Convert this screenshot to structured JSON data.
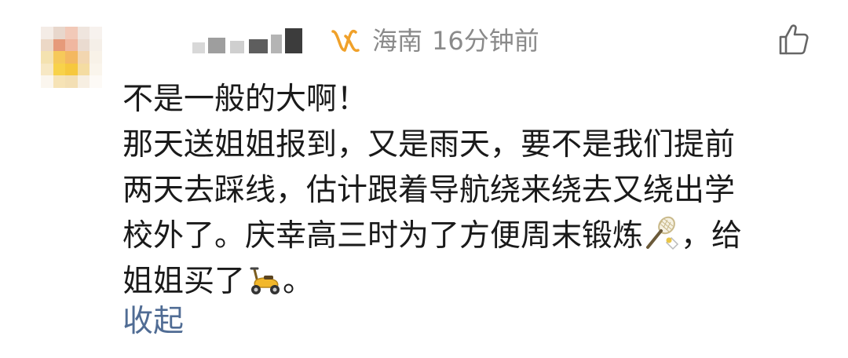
{
  "comment": {
    "location": "海南",
    "time": "16分钟前",
    "text_lines": [
      "不是一般的大啊！",
      "那天送姐姐报到，又是雨天，要不是我们提前",
      "两天去踩线，估计跟着导航绕来绕去又绕出学",
      "校外了。庆幸高三时为了方便周末锻炼",
      "，给",
      "姐姐买了",
      "。"
    ],
    "collapse_label": "收起",
    "icons": {
      "vip": "vip-badge-icon",
      "like": "thumbs-up-icon",
      "badminton": "badminton-emoji-icon",
      "scooter": "scooter-emoji-icon"
    }
  },
  "colors": {
    "meta_text": "#8a8a8a",
    "body_text": "#1a1a1a",
    "link": "#506c94",
    "vip_badge": "#f0a12a"
  }
}
